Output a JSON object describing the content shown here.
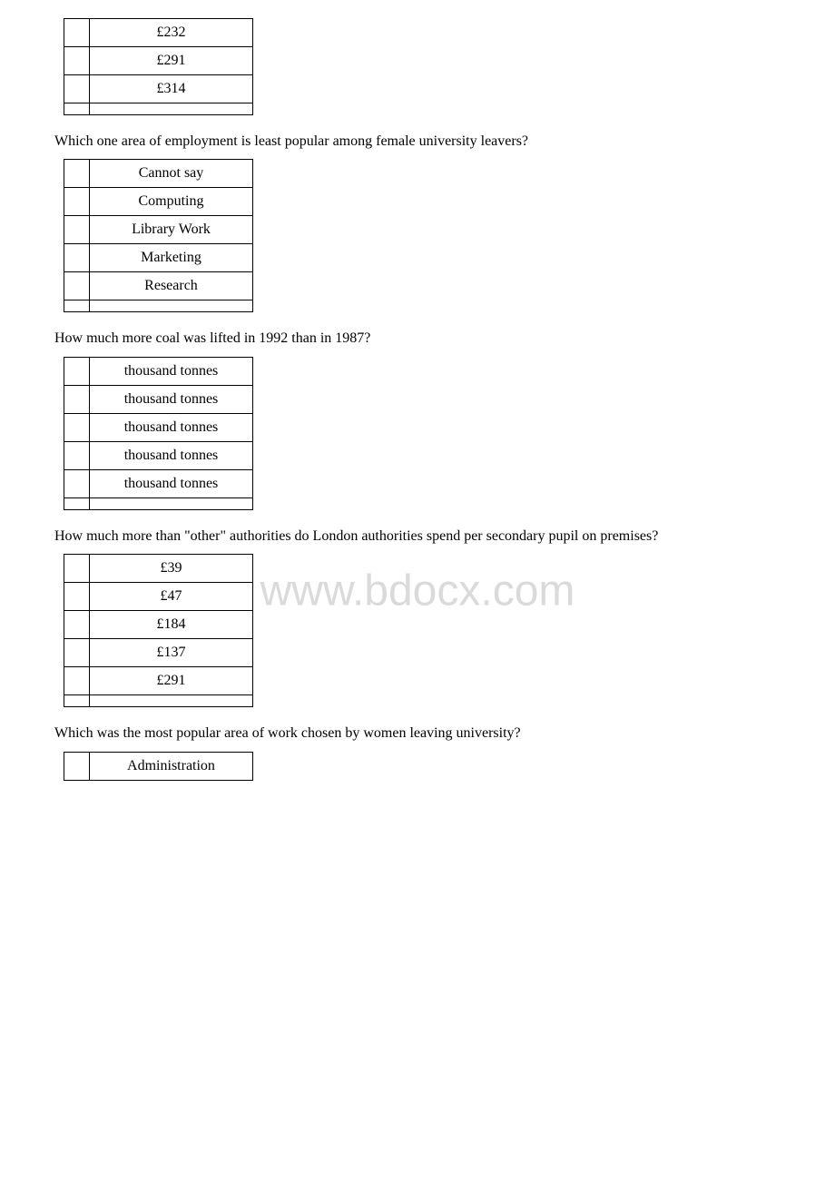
{
  "sections": [
    {
      "id": "section1",
      "question": null,
      "rows": [
        {
          "radio": "",
          "value": "£232"
        },
        {
          "radio": "",
          "value": "£291"
        },
        {
          "radio": "",
          "value": "£314"
        },
        {
          "radio": "",
          "value": ""
        }
      ]
    },
    {
      "id": "section2",
      "question": "Which one area of employment is least popular among female university leavers?",
      "rows": [
        {
          "radio": "",
          "value": "Cannot say"
        },
        {
          "radio": "",
          "value": "Computing"
        },
        {
          "radio": "",
          "value": "Library Work"
        },
        {
          "radio": "",
          "value": "Marketing"
        },
        {
          "radio": "",
          "value": "Research"
        },
        {
          "radio": "",
          "value": ""
        }
      ]
    },
    {
      "id": "section3",
      "question": "How much more coal was lifted in 1992 than in 1987?",
      "rows": [
        {
          "radio": "",
          "value": "thousand tonnes"
        },
        {
          "radio": "",
          "value": "thousand tonnes"
        },
        {
          "radio": "",
          "value": "thousand tonnes"
        },
        {
          "radio": "",
          "value": "thousand tonnes"
        },
        {
          "radio": "",
          "value": "thousand tonnes"
        },
        {
          "radio": "",
          "value": ""
        }
      ]
    },
    {
      "id": "section4",
      "question": "How much more than \"other\" authorities do London authorities spend per secondary pupil on premises?",
      "rows": [
        {
          "radio": "",
          "value": "£39"
        },
        {
          "radio": "",
          "value": "£47"
        },
        {
          "radio": "",
          "value": "£184"
        },
        {
          "radio": "",
          "value": "£137"
        },
        {
          "radio": "",
          "value": "£291"
        },
        {
          "radio": "",
          "value": ""
        }
      ]
    },
    {
      "id": "section5",
      "question": "Which was the most popular area of work chosen by women leaving university?",
      "rows": [
        {
          "radio": "",
          "value": "Administration"
        }
      ]
    }
  ]
}
